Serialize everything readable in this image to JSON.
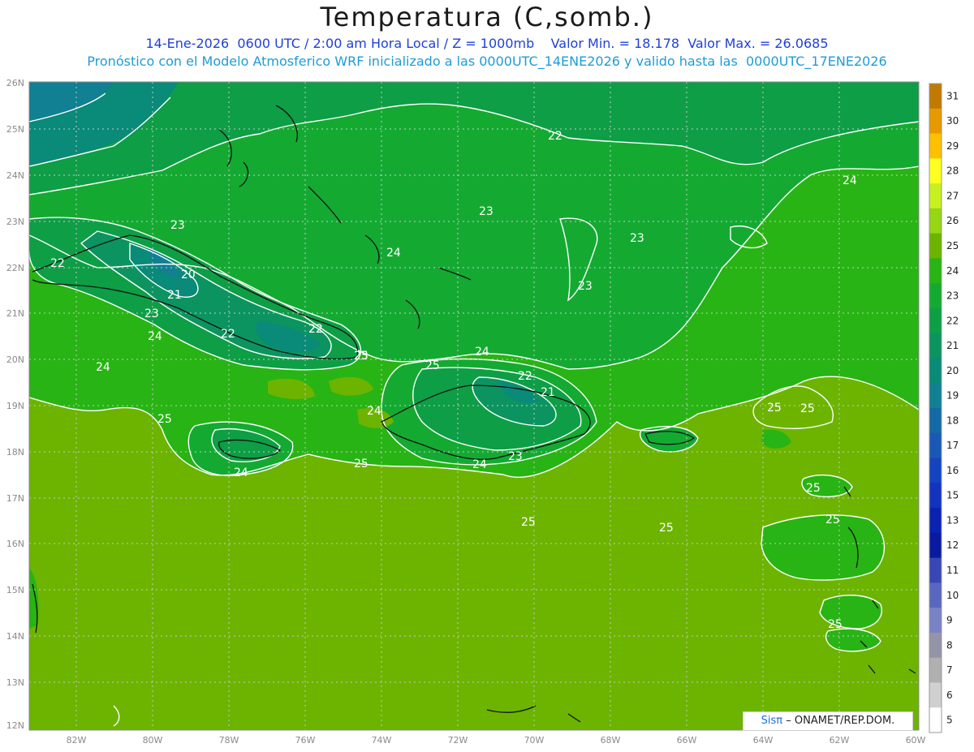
{
  "title": "Temperatura (C,somb.)",
  "subtitle_1": "14-Ene-2026  0600 UTC / 2:00 am Hora Local / Z = 1000mb    Valor Min. = 18.178  Valor Max. = 26.0685",
  "subtitle_2": "Pronóstico con el Modelo Atmosferico WRF inicializado a las 0000UTC_14ENE2026 y valido hasta las  0000UTC_17ENE2026",
  "credit": {
    "logo": "Sisπ",
    "text": "– ONAMET/REP.DOM."
  },
  "lat_ticks": [
    "26N",
    "25N",
    "24N",
    "23N",
    "22N",
    "21N",
    "20N",
    "19N",
    "18N",
    "17N",
    "16N",
    "15N",
    "14N",
    "13N",
    "12N"
  ],
  "lon_ticks": [
    "82W",
    "80W",
    "78W",
    "76W",
    "74W",
    "72W",
    "70W",
    "68W",
    "66W",
    "64W",
    "62W",
    "60W"
  ],
  "colorbar": {
    "labels": [
      "31",
      "30",
      "29",
      "28",
      "27",
      "26",
      "25",
      "24",
      "23",
      "22",
      "21",
      "20",
      "19",
      "18",
      "17",
      "16",
      "15",
      "13",
      "12",
      "11",
      "10",
      "9",
      "8",
      "7",
      "6",
      "5"
    ],
    "colors": [
      "#c07a00",
      "#e89900",
      "#ffc000",
      "#ffff20",
      "#c8f020",
      "#96d614",
      "#6cb400",
      "#28b414",
      "#14aa32",
      "#0e9e46",
      "#0c9460",
      "#0a8a78",
      "#108092",
      "#146aa6",
      "#1a58b6",
      "#1444c0",
      "#1232c0",
      "#0a22b2",
      "#0a1aa0",
      "#3a46b4",
      "#5a66c0",
      "#7a82c6",
      "#9494a8",
      "#b0b0b0",
      "#d0d0d0",
      "#ffffff"
    ]
  },
  "contour_labels": [
    "22",
    "23",
    "24",
    "22",
    "23",
    "23",
    "20",
    "21",
    "22",
    "22",
    "23",
    "24",
    "23",
    "24",
    "24",
    "23",
    "24",
    "22",
    "21",
    "25",
    "24",
    "23",
    "24",
    "25",
    "25",
    "25",
    "25",
    "25",
    "25",
    "24",
    "25",
    "25",
    "25",
    "25",
    "22"
  ]
}
